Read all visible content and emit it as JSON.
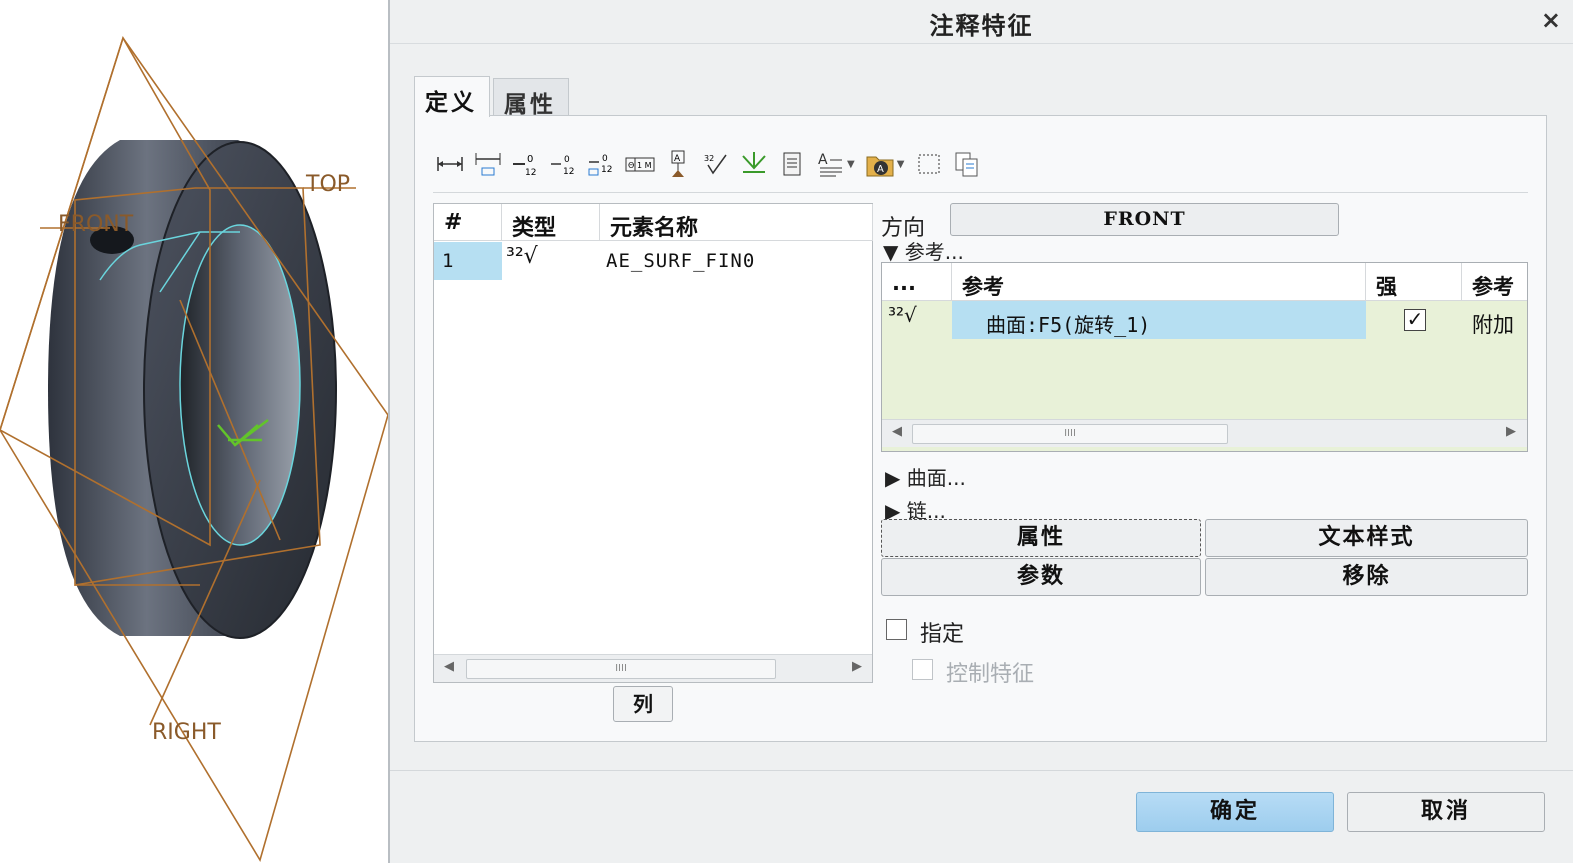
{
  "viewport": {
    "datum_labels": {
      "top": "TOP",
      "front": "FRONT",
      "right": "RIGHT"
    }
  },
  "dialog": {
    "title": "注释特征",
    "close_glyph": "×",
    "tabs": [
      {
        "label": "定义"
      },
      {
        "label": "属性"
      }
    ],
    "toolbar_icons": [
      "linear-dimension-icon",
      "baseline-dimension-icon",
      "datum-target-icon",
      "tolerance-icon",
      "stacked-tolerance-icon",
      "feature-control-frame-icon",
      "datum-feature-icon",
      "surface-finish-icon",
      "weld-symbol-icon",
      "note-icon",
      "text-style-icon",
      "symbol-palette-icon",
      "select-box-icon",
      "copy-paste-icon"
    ],
    "element_table": {
      "headers": [
        "#",
        "类型",
        "元素名称"
      ],
      "rows": [
        {
          "num": "1",
          "type_symbol": "³²√",
          "name": "AE_SURF_FIN0"
        }
      ],
      "scroll_thumb": "IIII"
    },
    "column_button": "列",
    "direction_label": "方向",
    "direction_value": "FRONT",
    "references_toggle": "▼ 参考...",
    "ref_table": {
      "headers": [
        "...",
        "参考",
        "强",
        "参考"
      ],
      "rows": [
        {
          "type_symbol": "³²√",
          "name": "曲面:F5(旋转_1)",
          "strong": true,
          "reference_type": "附加"
        }
      ],
      "scroll_thumb": "IIII"
    },
    "surfaces_toggle": "▶ 曲面...",
    "chains_toggle": "▶ 链...",
    "buttons": {
      "properties": "属性",
      "text_style": "文本样式",
      "parameters": "参数",
      "remove": "移除"
    },
    "checkbox_specify": "指定",
    "checkbox_control_feature": "控制特征",
    "ok": "确定",
    "cancel": "取消"
  },
  "colors": {
    "selection": "#b6dff2",
    "ref_table_bg": "#e8f1d8",
    "ok_button": "#a9d4f0",
    "datum_plane": "#b0702e",
    "model_body": "#3d4350"
  }
}
